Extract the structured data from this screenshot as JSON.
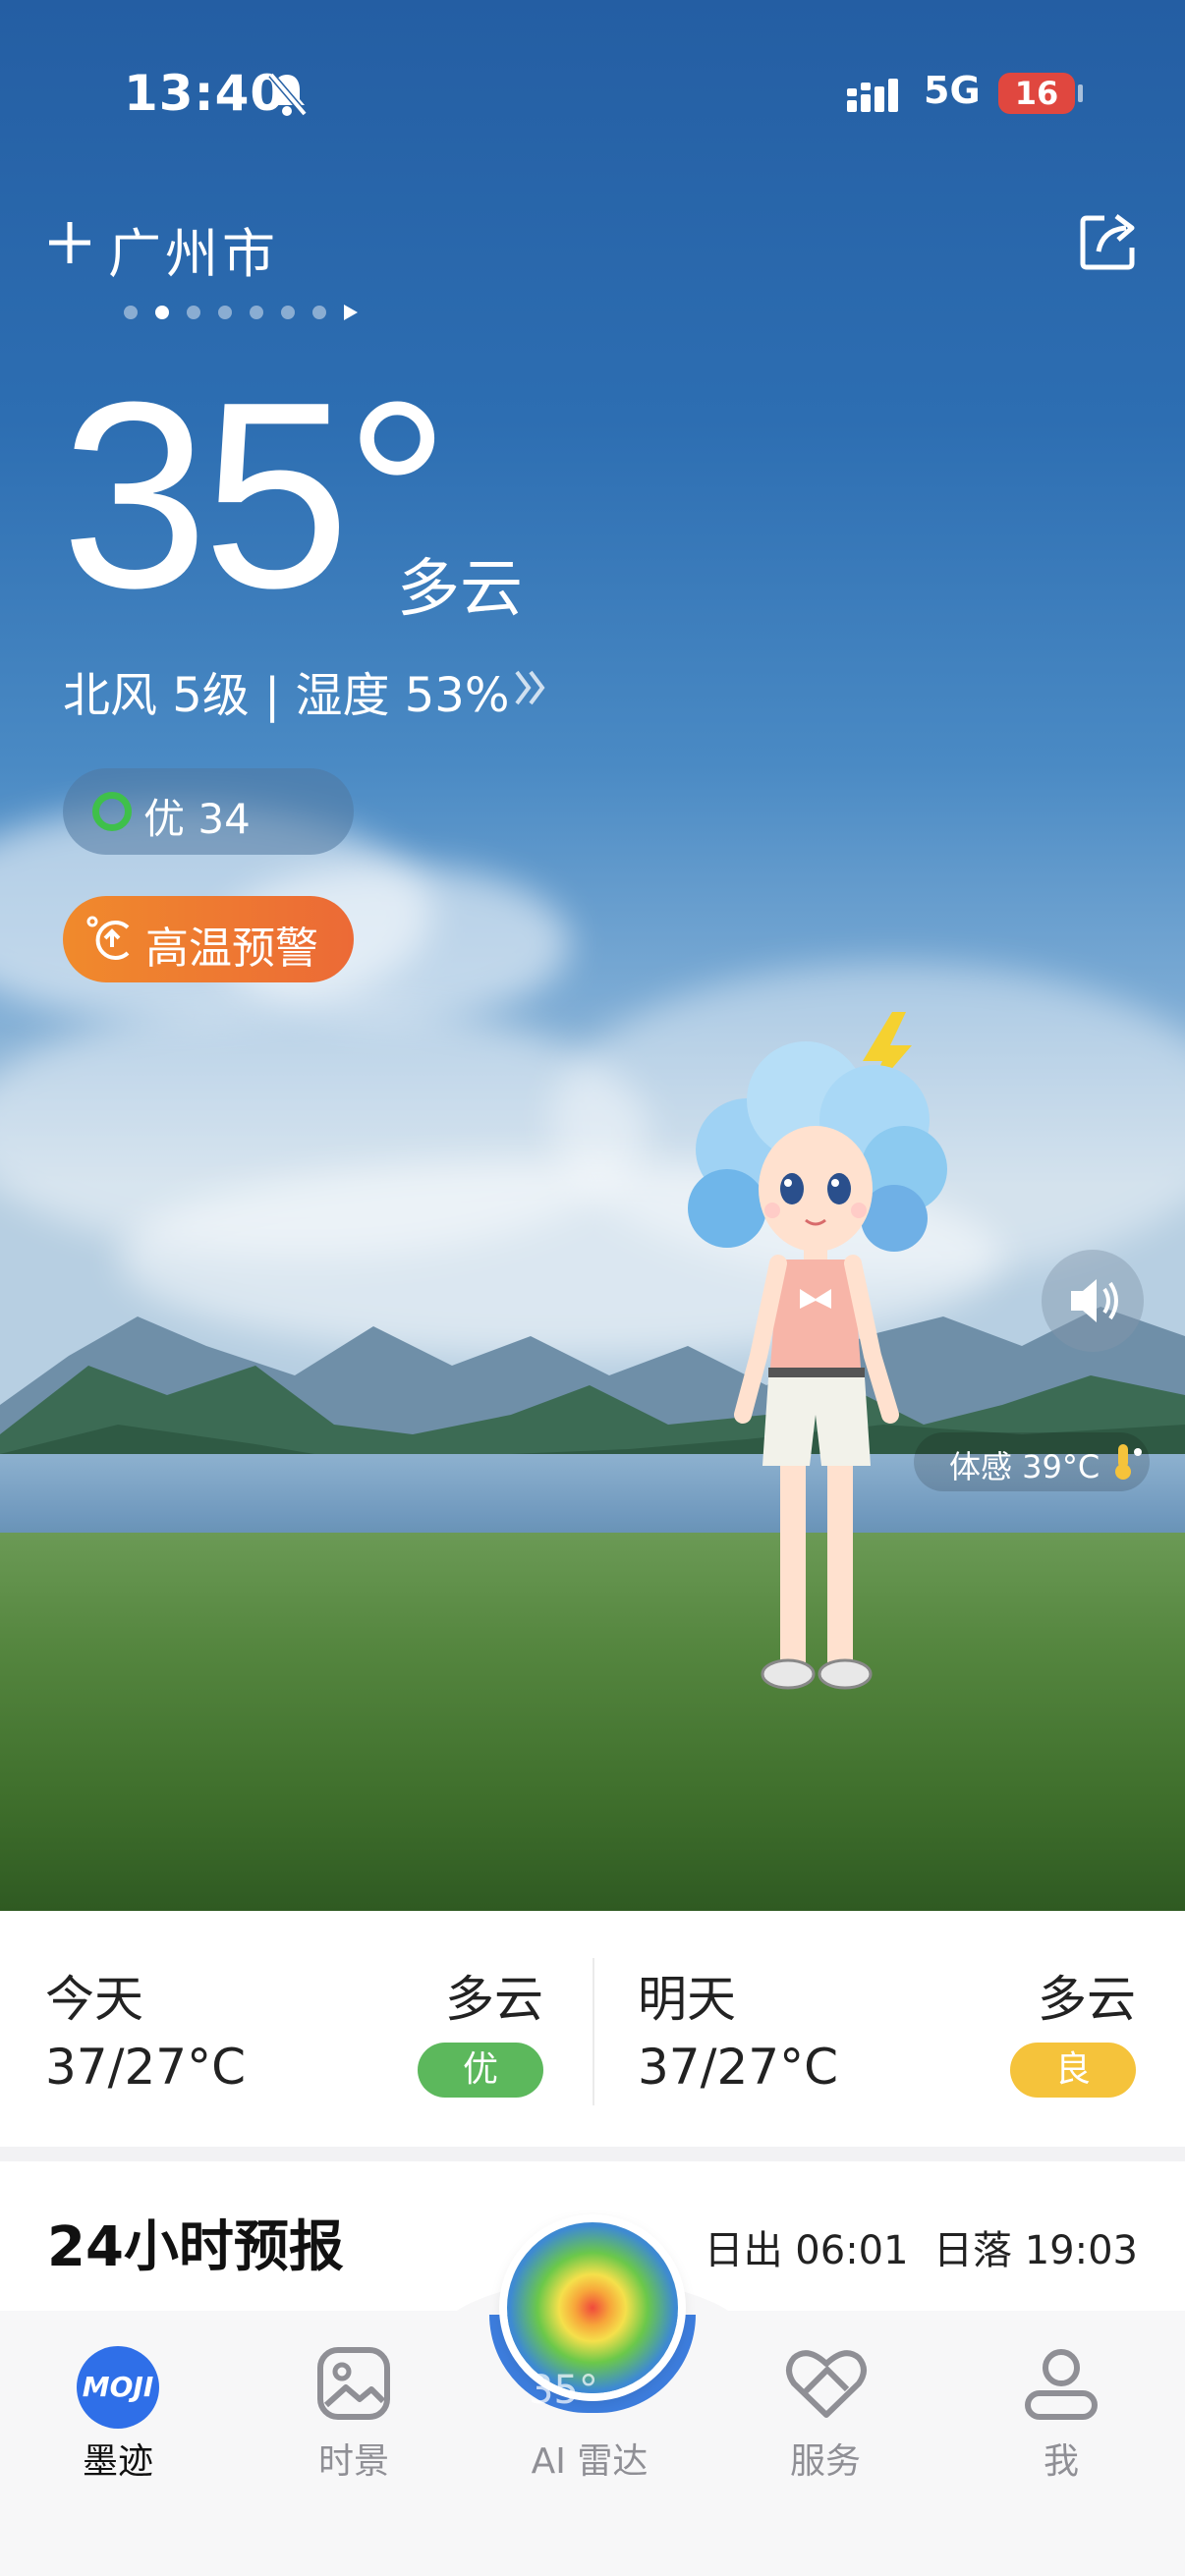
{
  "status_bar": {
    "time": "13:40",
    "network": "5G",
    "battery": "16"
  },
  "header": {
    "city": "广州市",
    "page_dots": 7,
    "active_dot": 1
  },
  "current": {
    "temperature": "35°",
    "condition": "多云",
    "wind_humidity": "北风 5级 | 湿度 53%",
    "aqi": "优 34",
    "warning": "高温预警",
    "feels_like": "体感 39°C"
  },
  "forecast": {
    "today": {
      "day": "今天",
      "condition": "多云",
      "temp": "37/27°C",
      "aqi": "优",
      "aqi_color": "#5cb85c"
    },
    "tomorrow": {
      "day": "明天",
      "condition": "多云",
      "temp": "37/27°C",
      "aqi": "良",
      "aqi_color": "#f5c33b"
    }
  },
  "hourly": {
    "title": "24小时预报",
    "sun_times": "日出 06:01  日落 19:03"
  },
  "tabbar": {
    "items": [
      {
        "label": "墨迹",
        "icon": "moji-logo-icon"
      },
      {
        "label": "时景",
        "icon": "gallery-icon"
      },
      {
        "label": "AI 雷达",
        "icon": "radar-icon"
      },
      {
        "label": "服务",
        "icon": "service-icon"
      },
      {
        "label": "我",
        "icon": "profile-icon"
      }
    ],
    "moji_logo_text": "MOJI",
    "radar_ghost_text": "35°"
  }
}
